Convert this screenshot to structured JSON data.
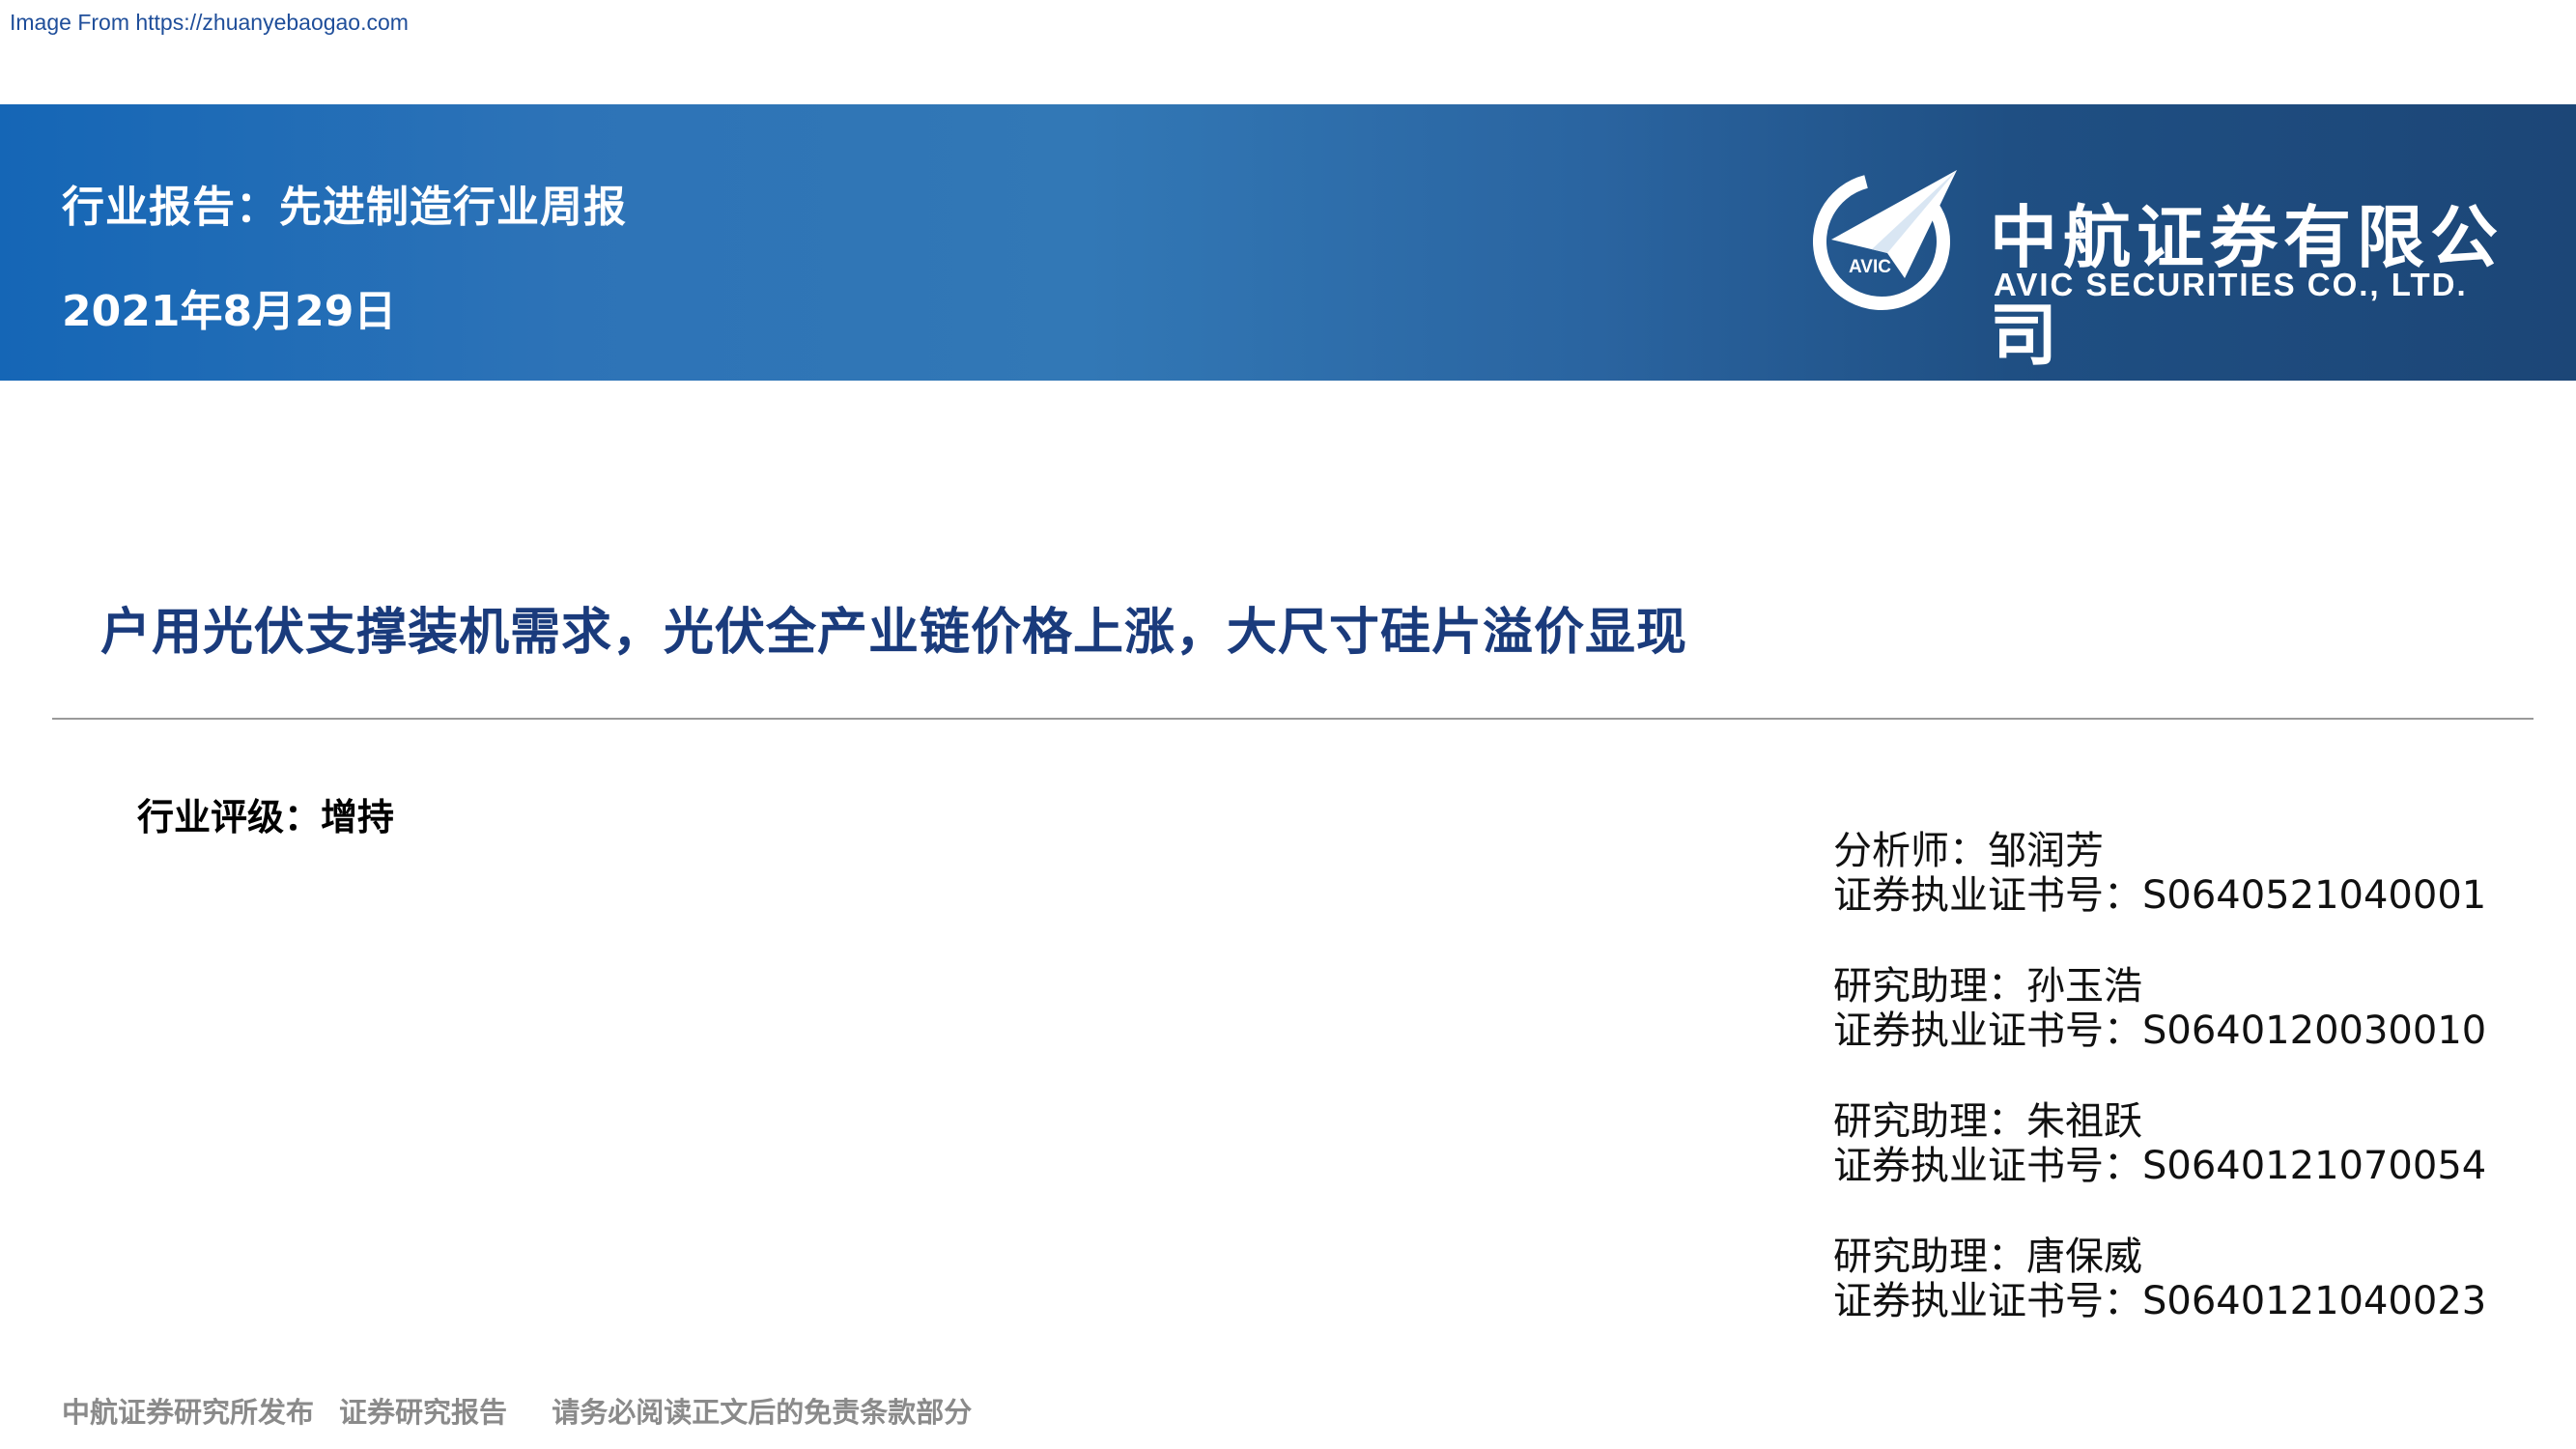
{
  "watermark": "Image From https://zhuanyebaogao.com",
  "banner": {
    "report_type": "行业报告：先进制造行业周报",
    "date": "2021年8月29日"
  },
  "logo": {
    "mark_text": "AVIC",
    "name_cn": "中航证券有限公司",
    "name_en": "AVIC SECURITIES CO., LTD."
  },
  "report_title": "户用光伏支撑装机需求，光伏全产业链价格上涨，大尺寸硅片溢价显现",
  "rating": "行业评级：增持",
  "analysts": [
    {
      "role_name": "分析师：邹润芳",
      "cert": "证券执业证书号：S0640521040001"
    },
    {
      "role_name": "研究助理：孙玉浩",
      "cert": "证券执业证书号：S0640120030010"
    },
    {
      "role_name": "研究助理：朱祖跃",
      "cert": "证券执业证书号：S0640121070054"
    },
    {
      "role_name": "研究助理：唐保威",
      "cert": "证券执业证书号：S0640121040023"
    }
  ],
  "footer": {
    "publisher": "中航证券研究所发布",
    "report_kind": "证券研究报告",
    "disclaimer": "请务必阅读正文后的免责条款部分"
  }
}
